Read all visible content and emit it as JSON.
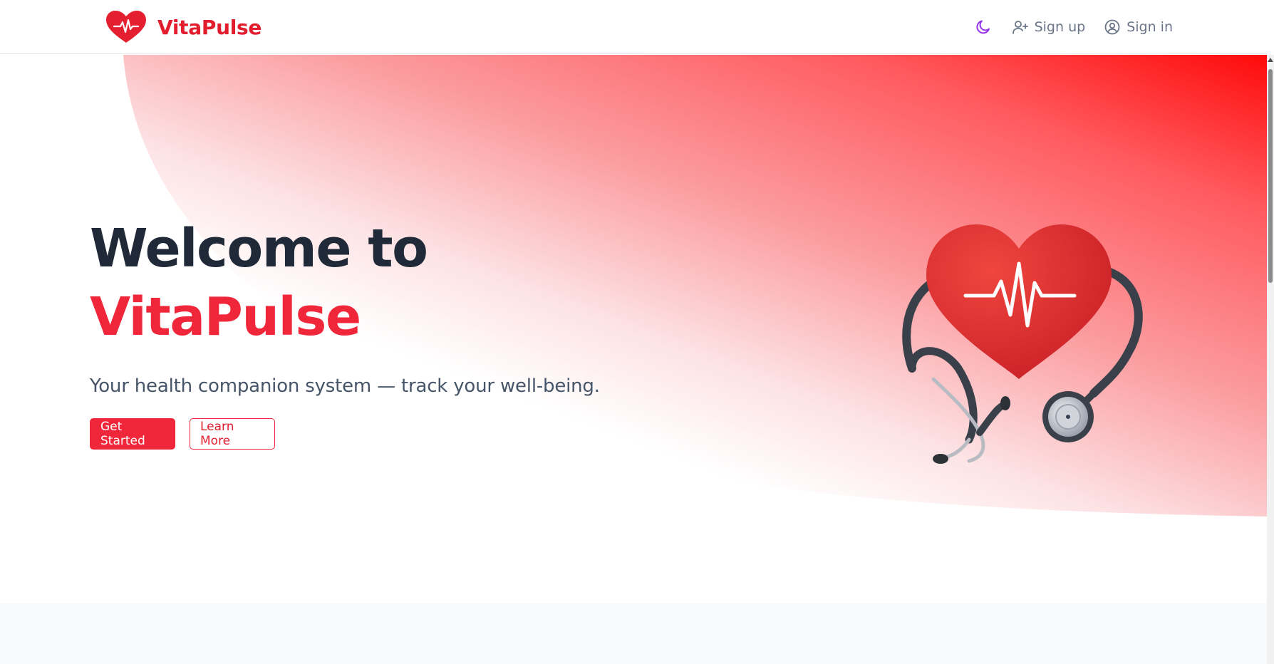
{
  "header": {
    "brand_name": "VitaPulse",
    "logo_icon": "heart-pulse-icon",
    "theme_icon": "moon-icon",
    "signup": {
      "label": "Sign up",
      "icon": "user-plus-icon"
    },
    "signin": {
      "label": "Sign in",
      "icon": "user-circle-icon"
    }
  },
  "hero": {
    "title_line1": "Welcome to",
    "title_line2": "VitaPulse",
    "subtitle": "Your health companion system — track your well-being.",
    "primary_button": "Get Started",
    "secondary_button": "Learn More",
    "illustration": "heart-stethoscope-illustration"
  },
  "colors": {
    "brand_red": "#e11d2e",
    "accent_red": "#f0273a",
    "heading_dark": "#1f2937",
    "muted_text": "#475569",
    "nav_text": "#6b7588",
    "moon_purple": "#9333ea"
  }
}
